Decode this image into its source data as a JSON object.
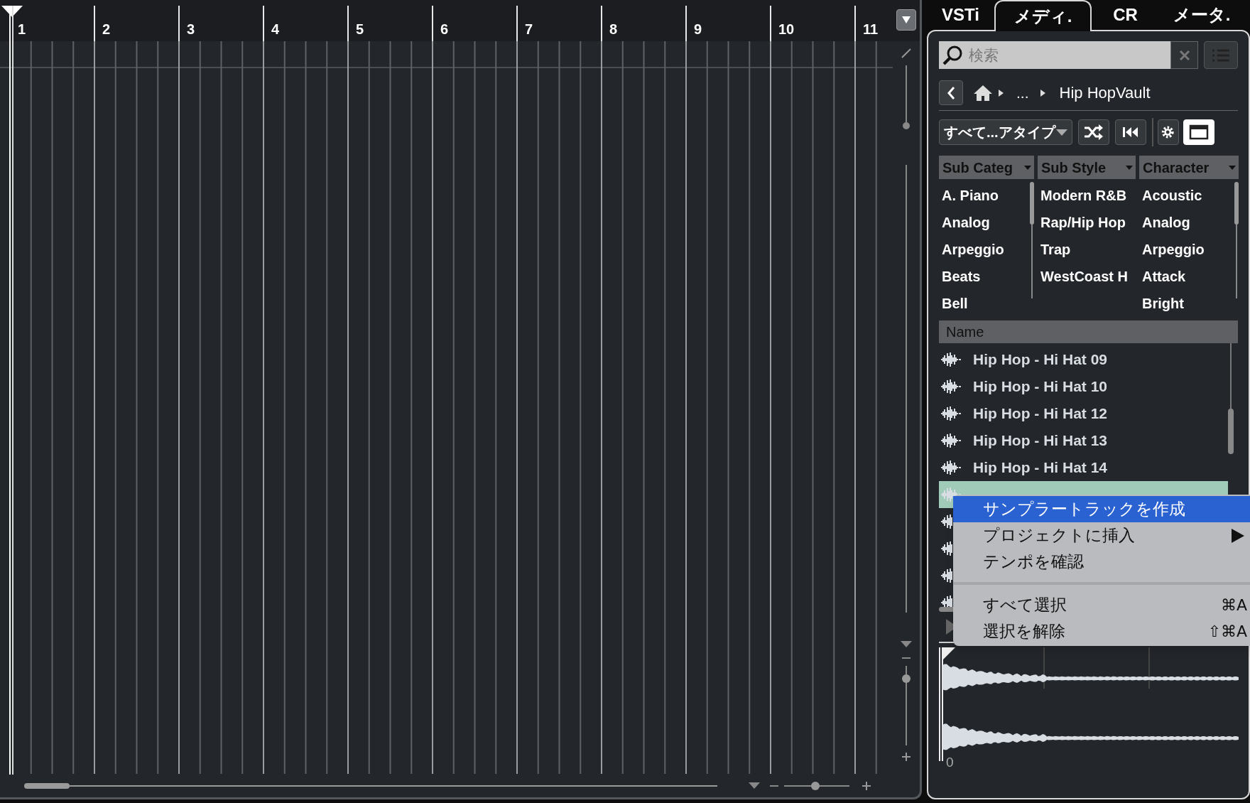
{
  "ruler": {
    "bars": [
      "1",
      "2",
      "3",
      "4",
      "5",
      "6",
      "7",
      "8",
      "9",
      "10",
      "11"
    ]
  },
  "editor": {
    "horizontal_zoom": {
      "level": 0.47
    }
  },
  "tabs": [
    {
      "label": "VSTi",
      "selected": false
    },
    {
      "label": "メディ.",
      "selected": true
    },
    {
      "label": "CR",
      "selected": false
    },
    {
      "label": "メータ.",
      "selected": false
    }
  ],
  "search": {
    "placeholder": "検索"
  },
  "breadcrumb": [
    "...",
    "Hip HopVault"
  ],
  "toolbar": {
    "filter": "すべて...アタイプ",
    "buttons": [
      {
        "kind": "shuffle",
        "on": false
      },
      {
        "kind": "rewind",
        "on": false
      },
      {
        "kind": "settings",
        "on": false
      },
      {
        "kind": "window",
        "on": true
      }
    ]
  },
  "filters": [
    {
      "header": "Sub Categ",
      "items": [
        "A. Piano",
        "Analog",
        "Arpeggio",
        "Beats",
        "Bell"
      ]
    },
    {
      "header": "Sub Style",
      "items": [
        "Modern R&B",
        "Rap/Hip Hop",
        "Trap",
        "WestCoast H"
      ]
    },
    {
      "header": "Character",
      "items": [
        "Acoustic",
        "Analog",
        "Arpeggio",
        "Attack",
        "Bright"
      ]
    }
  ],
  "list": {
    "header": "Name",
    "rows": [
      {
        "name": "Hip Hop - Hi Hat 09",
        "selected": false
      },
      {
        "name": "Hip Hop - Hi Hat 10",
        "selected": false
      },
      {
        "name": "Hip Hop - Hi Hat 12",
        "selected": false
      },
      {
        "name": "Hip Hop - Hi Hat 13",
        "selected": false
      },
      {
        "name": "Hip Hop - Hi Hat 14",
        "selected": false
      },
      {
        "selected": true
      },
      {
        "selected": false
      },
      {
        "selected": false
      },
      {
        "selected": false
      },
      {
        "selected": false
      }
    ]
  },
  "context_menu": {
    "groups": [
      [
        {
          "label": "サンプラートラックを作成",
          "submenu": false,
          "selected": true
        },
        {
          "label": "プロジェクトに挿入",
          "submenu": true,
          "selected": false
        },
        {
          "label": "テンポを確認",
          "submenu": false,
          "selected": false
        }
      ],
      [
        {
          "label": "すべて選択",
          "shortcut": "⌘A",
          "submenu": false,
          "selected": false
        },
        {
          "label": "選択を解除",
          "shortcut": "⇧⌘A",
          "submenu": false,
          "selected": false
        }
      ]
    ]
  },
  "preview": {
    "time_label": "0"
  }
}
